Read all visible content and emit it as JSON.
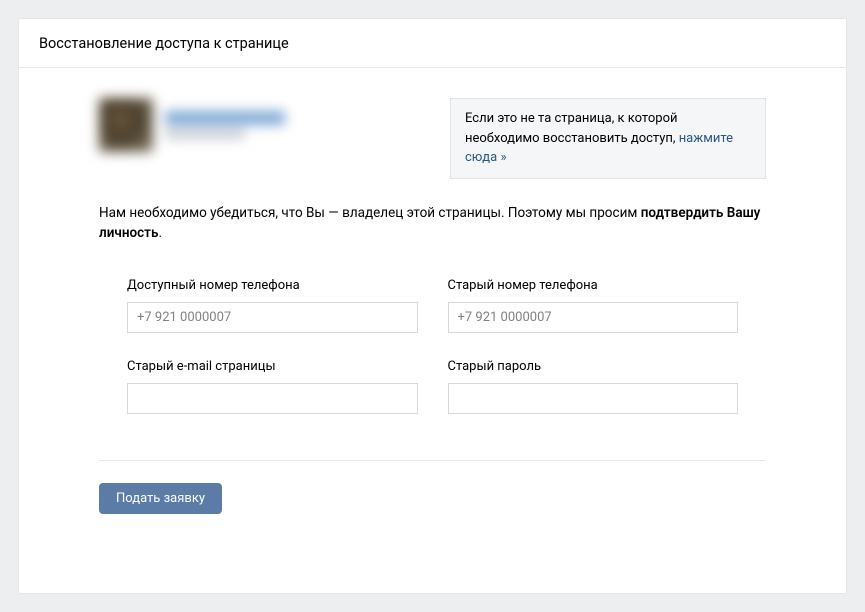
{
  "header": {
    "title": "Восстановление доступа к странице"
  },
  "info_box": {
    "text_before": "Если это не та страница, к которой необходимо восстановить доступ, ",
    "link_text": "нажмите сюда »"
  },
  "description": {
    "text_before": "Нам необходимо убедиться, что Вы — владелец этой страницы. Поэтому мы просим ",
    "bold_text": "подтвердить Вашу личность",
    "text_after": "."
  },
  "form": {
    "available_phone": {
      "label": "Доступный номер телефона",
      "placeholder": "+7 921 0000007",
      "value": ""
    },
    "old_phone": {
      "label": "Старый номер телефона",
      "placeholder": "+7 921 0000007",
      "value": ""
    },
    "old_email": {
      "label": "Старый e-mail страницы",
      "value": ""
    },
    "old_password": {
      "label": "Старый пароль",
      "value": ""
    }
  },
  "submit": {
    "label": "Подать заявку"
  }
}
